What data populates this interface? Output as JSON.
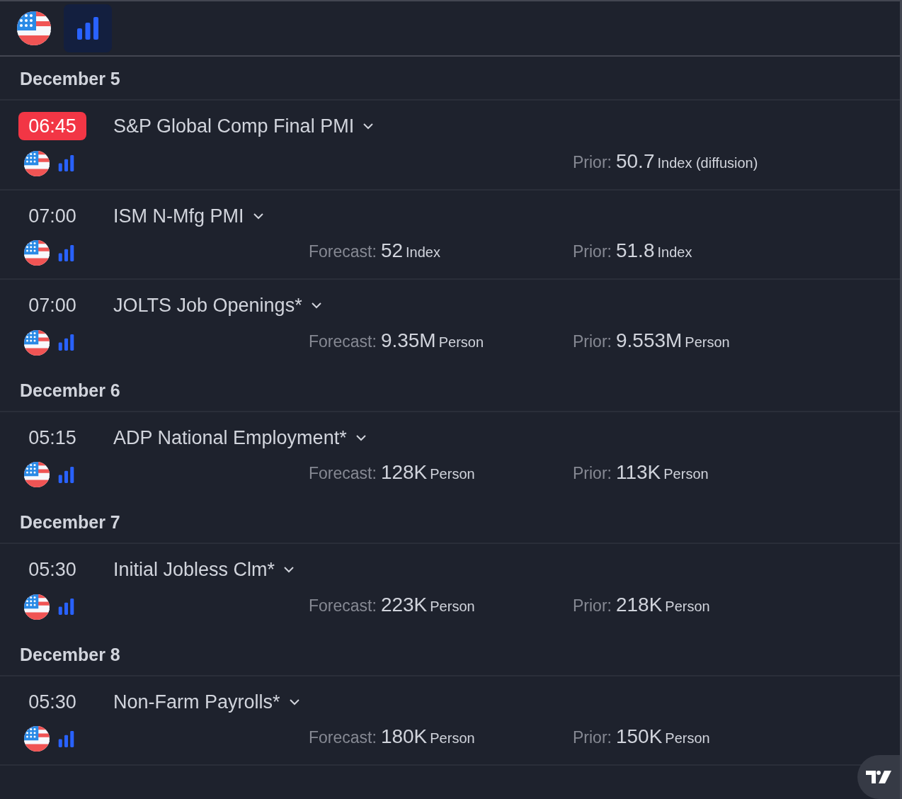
{
  "toolbar": {
    "filter_selected": true
  },
  "days": [
    {
      "date": "December 5",
      "events": [
        {
          "time": "06:45",
          "highlighted": true,
          "title": "S&P Global Comp Final PMI",
          "prior": {
            "label": "Prior:",
            "value": "50.7",
            "unit": "Index (diffusion)"
          }
        },
        {
          "time": "07:00",
          "highlighted": false,
          "title": "ISM N-Mfg PMI",
          "forecast": {
            "label": "Forecast:",
            "value": "52",
            "unit": "Index"
          },
          "prior": {
            "label": "Prior:",
            "value": "51.8",
            "unit": "Index"
          }
        },
        {
          "time": "07:00",
          "highlighted": false,
          "title": "JOLTS Job Openings*",
          "forecast": {
            "label": "Forecast:",
            "value": "9.35M",
            "unit": "Person"
          },
          "prior": {
            "label": "Prior:",
            "value": "9.553M",
            "unit": "Person"
          }
        }
      ]
    },
    {
      "date": "December 6",
      "events": [
        {
          "time": "05:15",
          "highlighted": false,
          "title": "ADP National Employment*",
          "forecast": {
            "label": "Forecast:",
            "value": "128K",
            "unit": "Person"
          },
          "prior": {
            "label": "Prior:",
            "value": "113K",
            "unit": "Person"
          }
        }
      ]
    },
    {
      "date": "December 7",
      "events": [
        {
          "time": "05:30",
          "highlighted": false,
          "title": "Initial Jobless Clm*",
          "forecast": {
            "label": "Forecast:",
            "value": "223K",
            "unit": "Person"
          },
          "prior": {
            "label": "Prior:",
            "value": "218K",
            "unit": "Person"
          }
        }
      ]
    },
    {
      "date": "December 8",
      "events": [
        {
          "time": "05:30",
          "highlighted": false,
          "title": "Non-Farm Payrolls*",
          "forecast": {
            "label": "Forecast:",
            "value": "180K",
            "unit": "Person"
          },
          "prior": {
            "label": "Prior:",
            "value": "150K",
            "unit": "Person"
          }
        }
      ]
    }
  ]
}
